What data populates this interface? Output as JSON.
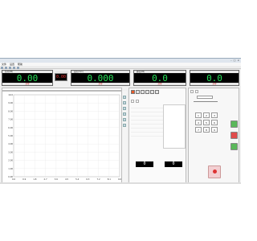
{
  "app": {
    "window_title": "",
    "menu": [
      "文件",
      "设置",
      "帮助"
    ]
  },
  "displays": [
    {
      "header": "负荷(kN)",
      "value": "0.00",
      "footer": "清零"
    },
    {
      "header": "变形(mm)",
      "value": "0.000",
      "footer": "清零"
    },
    {
      "header": "峰值(kN)",
      "value": "0.0",
      "footer": "清零"
    },
    {
      "header": "",
      "value": "0.0",
      "footer": "清零"
    }
  ],
  "mini_display": {
    "label": "",
    "value": "0.00"
  },
  "readout_bar": {
    "text": ""
  },
  "chart_data": {
    "type": "line",
    "title": "",
    "xlabel": "",
    "ylabel": "",
    "xlim": [
      0,
      10
    ],
    "ylim": [
      0,
      10
    ],
    "x_ticks": [
      "0.0",
      "0.9",
      "1.8",
      "2.7",
      "3.6",
      "4.5",
      "5.4",
      "6.3",
      "7.2",
      "8.1",
      "9.0"
    ],
    "y_ticks": [
      "10.0",
      "9.00",
      "8.00",
      "7.00",
      "6.00",
      "5.00",
      "4.00",
      "3.00",
      "2.00",
      "1.00",
      "0.00"
    ],
    "grid": true,
    "series": []
  },
  "middle": {
    "tabs": [
      "",
      ""
    ],
    "rows": [
      "",
      "",
      "",
      "",
      "",
      "",
      "",
      ""
    ],
    "sample": {
      "caption": "",
      "left_label": "",
      "left_value": "0",
      "right_label": "",
      "right_value": "0"
    }
  },
  "right": {
    "tabs": [
      "",
      ""
    ],
    "field_label": "",
    "field_value": "",
    "keypad": [
      "1",
      "2",
      "3",
      "4",
      "5",
      "6",
      "7",
      "8",
      "9"
    ],
    "stop_label": ""
  }
}
